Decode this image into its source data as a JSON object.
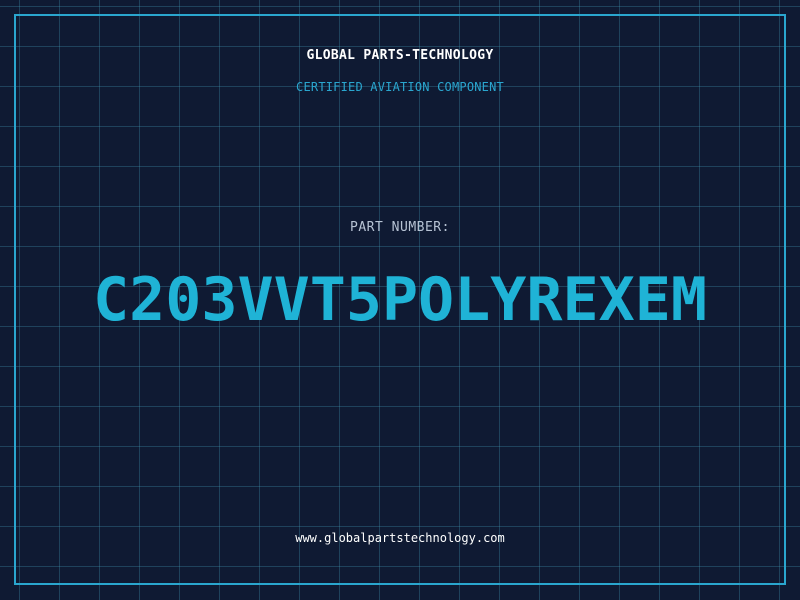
{
  "header": {
    "company_name": "GLOBAL PARTS-TECHNOLOGY",
    "tagline": "CERTIFIED AVIATION COMPONENT"
  },
  "part": {
    "label": "PART NUMBER:",
    "number": "C203VVT5POLYREXEM"
  },
  "footer": {
    "website": "www.globalpartstechnology.com"
  },
  "colors": {
    "background": "#0f1a33",
    "accent": "#2aa6cf",
    "part_number": "#1fb3d6",
    "grid": "#2d5a72"
  }
}
